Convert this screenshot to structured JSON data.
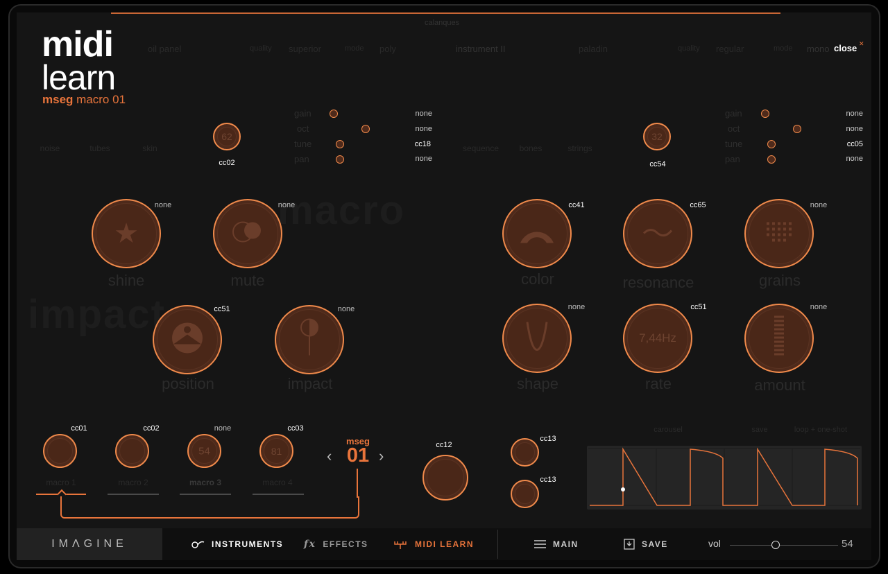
{
  "header": {
    "title_line1": "midi",
    "title_line2": "learn",
    "subtitle_bold": "mseg",
    "subtitle_rest": "macro 01",
    "close_label": "close"
  },
  "background": {
    "preset_name": "calanques",
    "instrument_name": "instrument II",
    "left_sound": "oil panel",
    "right_sound": "paladin",
    "quality_label": "quality",
    "left_quality": "superior",
    "right_quality": "regular",
    "mode_label": "mode",
    "left_mode": "poly",
    "right_mode": "mono",
    "left_layers": [
      "noise",
      "tubes",
      "skin"
    ],
    "right_layers": [
      "sequence",
      "bones",
      "strings"
    ],
    "big_words": [
      "macro",
      "impact"
    ],
    "knob_labels": [
      "shine",
      "mute",
      "color",
      "resonance",
      "grains",
      "position",
      "impact",
      "shape",
      "rate",
      "amount"
    ],
    "macro_labels": [
      "macro 1",
      "macro 2",
      "macro 3",
      "macro 4"
    ],
    "mseg_preset": "carousel",
    "mseg_save": "save",
    "mseg_mode": "loop + one-shot"
  },
  "layer_left": {
    "knob_value": "62",
    "knob_cc": "cc02",
    "params": [
      {
        "name": "gain",
        "cc": "none"
      },
      {
        "name": "oct",
        "cc": "none"
      },
      {
        "name": "tune",
        "cc": "cc18"
      },
      {
        "name": "pan",
        "cc": "none"
      }
    ]
  },
  "layer_right": {
    "knob_value": "32",
    "knob_cc": "cc54",
    "params": [
      {
        "name": "gain",
        "cc": "none"
      },
      {
        "name": "oct",
        "cc": "none"
      },
      {
        "name": "tune",
        "cc": "cc05"
      },
      {
        "name": "pan",
        "cc": "none"
      }
    ]
  },
  "big_knobs": {
    "shine": {
      "cc": "none"
    },
    "mute": {
      "cc": "none"
    },
    "color": {
      "cc": "cc41"
    },
    "resonance": {
      "cc": "cc65"
    },
    "grains": {
      "cc": "none"
    },
    "position": {
      "cc": "cc51"
    },
    "impact": {
      "cc": "none"
    },
    "shape": {
      "cc": "none"
    },
    "rate": {
      "cc": "cc51",
      "value": "7,44Hz"
    },
    "amount": {
      "cc": "none"
    }
  },
  "macros": [
    {
      "cc": "cc01",
      "value": "",
      "active": true
    },
    {
      "cc": "cc02",
      "value": ""
    },
    {
      "cc": "none",
      "value": "54"
    },
    {
      "cc": "cc03",
      "value": "81"
    }
  ],
  "mseg": {
    "label": "mseg",
    "number": "01",
    "main_cc": "cc12",
    "small_cc_1": "cc13",
    "small_cc_2": "cc13",
    "small_value_1": "",
    "small_value_2": ""
  },
  "bottom_bar": {
    "brand": "IMΛGINE",
    "nav": [
      "INSTRUMENTS",
      "EFFECTS",
      "MIDI LEARN"
    ],
    "nav_active": "MIDI LEARN",
    "main_label": "MAIN",
    "save_label": "SAVE",
    "vol_label": "vol",
    "vol_value": "54",
    "vol_fraction": 0.42
  },
  "colors": {
    "accent": "#e8743b",
    "panel": "#151515",
    "knob_fill": "#4e2a1b",
    "text": "#ffffff"
  }
}
